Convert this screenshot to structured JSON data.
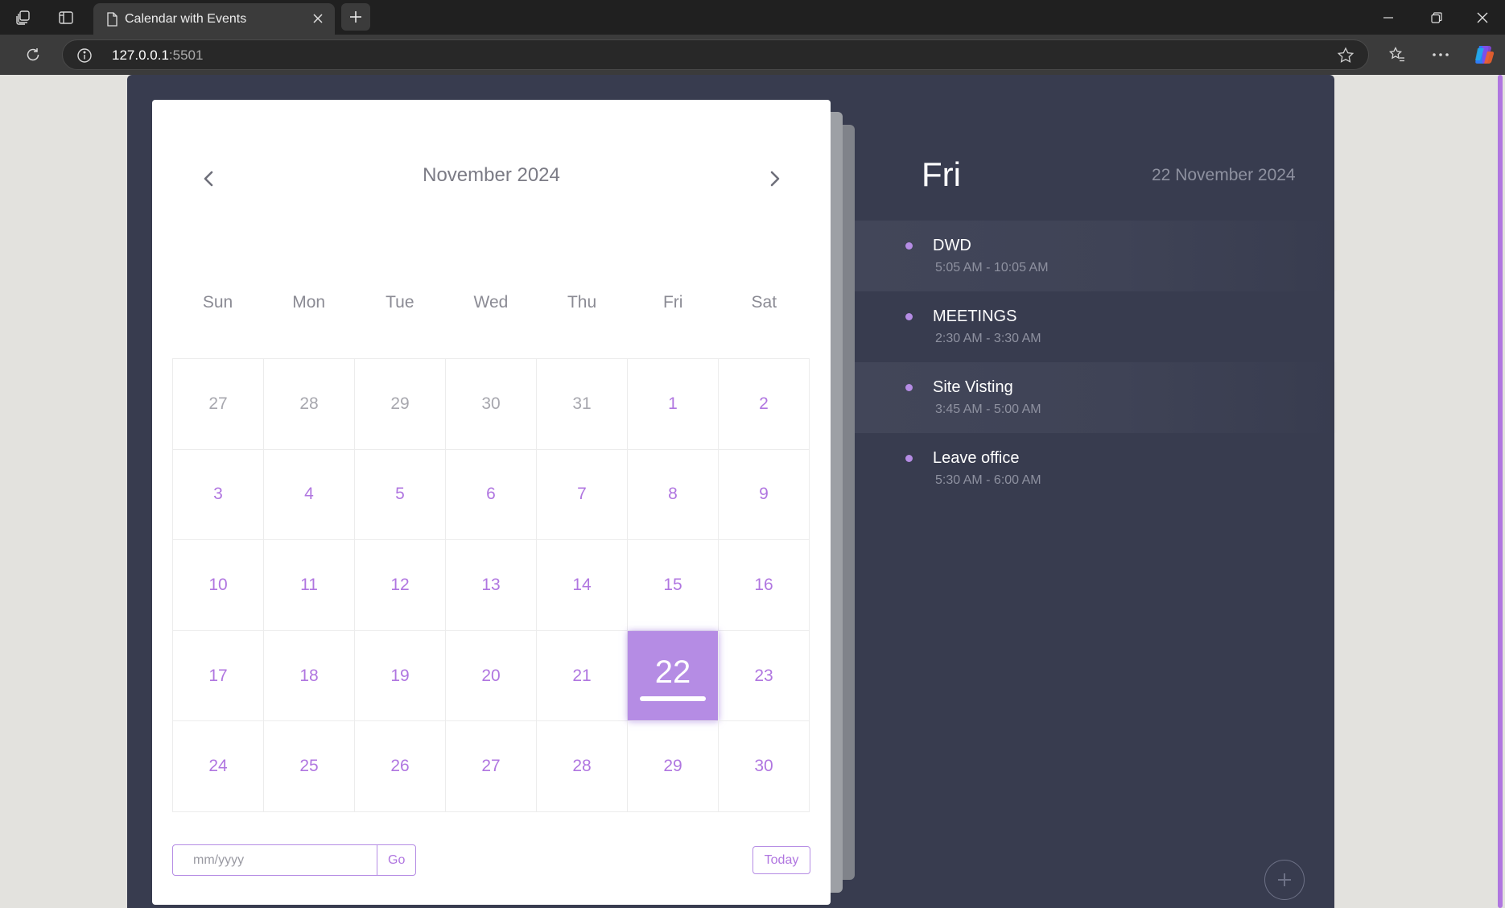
{
  "browser": {
    "tab_title": "Calendar with Events",
    "url_host": "127.0.0.1",
    "url_port": ":5501"
  },
  "calendar": {
    "month_title": "November 2024",
    "weekdays": [
      "Sun",
      "Mon",
      "Tue",
      "Wed",
      "Thu",
      "Fri",
      "Sat"
    ],
    "days": [
      {
        "label": "27",
        "other": true
      },
      {
        "label": "28",
        "other": true
      },
      {
        "label": "29",
        "other": true
      },
      {
        "label": "30",
        "other": true
      },
      {
        "label": "31",
        "other": true
      },
      {
        "label": "1"
      },
      {
        "label": "2"
      },
      {
        "label": "3"
      },
      {
        "label": "4"
      },
      {
        "label": "5"
      },
      {
        "label": "6"
      },
      {
        "label": "7"
      },
      {
        "label": "8"
      },
      {
        "label": "9"
      },
      {
        "label": "10"
      },
      {
        "label": "11"
      },
      {
        "label": "12"
      },
      {
        "label": "13"
      },
      {
        "label": "14"
      },
      {
        "label": "15"
      },
      {
        "label": "16"
      },
      {
        "label": "17"
      },
      {
        "label": "18"
      },
      {
        "label": "19"
      },
      {
        "label": "20"
      },
      {
        "label": "21"
      },
      {
        "label": "22",
        "active": true
      },
      {
        "label": "23"
      },
      {
        "label": "24"
      },
      {
        "label": "25"
      },
      {
        "label": "26"
      },
      {
        "label": "27"
      },
      {
        "label": "28"
      },
      {
        "label": "29"
      },
      {
        "label": "30"
      }
    ],
    "goto_placeholder": "mm/yyyy",
    "go_label": "Go",
    "today_label": "Today"
  },
  "events_panel": {
    "day_name": "Fri",
    "full_date": "22 November 2024",
    "events": [
      {
        "title": "DWD",
        "time": "5:05 AM - 10:05 AM",
        "shaded": true
      },
      {
        "title": "MEETINGS",
        "time": "2:30 AM - 3:30 AM",
        "shaded": false
      },
      {
        "title": "Site Visting",
        "time": "3:45 AM - 5:00 AM",
        "shaded": true
      },
      {
        "title": "Leave office",
        "time": "5:30 AM - 6:00 AM",
        "shaded": false
      }
    ]
  },
  "icons": {
    "prev": "chevron-left-icon",
    "next": "chevron-right-icon",
    "add": "plus-icon"
  },
  "colors": {
    "accent": "#b076e0",
    "active_day": "#b58ce4",
    "panel_bg": "#383c4f"
  }
}
